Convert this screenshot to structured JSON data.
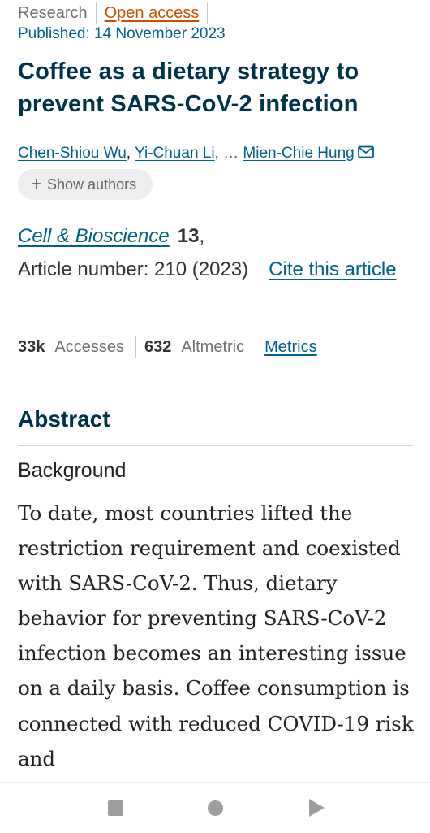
{
  "article": {
    "type": "Research",
    "access": "Open access",
    "published": "Published: 14 November 2023",
    "title": "Coffee as a dietary strategy to prevent SARS-CoV-2 infection"
  },
  "authors": {
    "list": [
      "Chen-Shiou Wu",
      "Yi-Chuan Li",
      "Mien-Chie Hung"
    ],
    "separator": ",",
    "ellipsis": "…",
    "show_authors_label": "Show authors"
  },
  "citation": {
    "journal": "Cell & Bioscience",
    "volume": "13",
    "volume_suffix": ",",
    "article_number": "Article number: 210 (2023)",
    "cite_label": "Cite this article"
  },
  "metrics": {
    "accesses_value": "33k",
    "accesses_label": "Accesses",
    "altmetric_value": "632",
    "altmetric_label": "Altmetric",
    "metrics_link": "Metrics"
  },
  "abstract": {
    "heading": "Abstract",
    "section_heading": "Background",
    "text": "To date, most countries lifted the restriction requirement and coexisted with SARS-CoV-2. Thus, dietary behavior for preventing SARS-CoV-2 infection becomes an interesting issue on a daily basis. Coffee consumption is connected with reduced COVID-19 risk and"
  },
  "colors": {
    "link": "#025e8d",
    "heading": "#01324b",
    "open_access": "#c65301",
    "muted": "#707070",
    "nav_icon": "#9e9e9e"
  },
  "navbar": {
    "icons": [
      "recents-square-icon",
      "home-circle-icon",
      "back-triangle-icon"
    ]
  }
}
